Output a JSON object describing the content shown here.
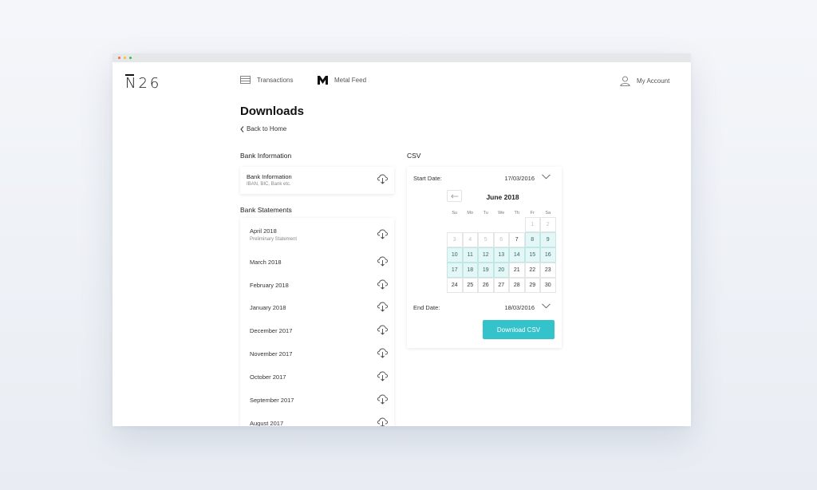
{
  "app": {
    "logo": "N26"
  },
  "nav": {
    "transactions": "Transactions",
    "metal_feed": "Metal Feed",
    "account": "My Account"
  },
  "page": {
    "title": "Downloads",
    "back_label": "Back to Home"
  },
  "bank_info": {
    "section_label": "Bank Information",
    "card_title": "Bank Information",
    "card_sub": "IBAN, BIC, Bank etc."
  },
  "statements": {
    "section_label": "Bank Statements",
    "items": [
      {
        "label": "April 2018",
        "sub": "Preliminary Statement"
      },
      {
        "label": "March 2018",
        "sub": ""
      },
      {
        "label": "February 2018",
        "sub": ""
      },
      {
        "label": "January 2018",
        "sub": ""
      },
      {
        "label": "December 2017",
        "sub": ""
      },
      {
        "label": "November 2017",
        "sub": ""
      },
      {
        "label": "October 2017",
        "sub": ""
      },
      {
        "label": "September 2017",
        "sub": ""
      },
      {
        "label": "August 2017",
        "sub": ""
      }
    ]
  },
  "csv": {
    "section_label": "CSV",
    "start_label": "Start Date:",
    "start_value": "17/03/2016",
    "end_label": "End Date:",
    "end_value": "18/03/2016",
    "button": "Download CSV",
    "calendar": {
      "month": "June 2018",
      "weekdays": [
        "Su",
        "Mo",
        "Tu",
        "We",
        "Th",
        "Fr",
        "Sa"
      ],
      "weeks": [
        [
          null,
          null,
          null,
          null,
          null,
          {
            "d": "1",
            "s": "muted"
          },
          {
            "d": "2",
            "s": "muted"
          }
        ],
        [
          {
            "d": "3",
            "s": "muted"
          },
          {
            "d": "4",
            "s": "muted"
          },
          {
            "d": "5",
            "s": "muted"
          },
          {
            "d": "6",
            "s": "muted"
          },
          {
            "d": "7",
            "s": ""
          },
          {
            "d": "8",
            "s": "sel"
          },
          {
            "d": "9",
            "s": "sel"
          }
        ],
        [
          {
            "d": "10",
            "s": "sel"
          },
          {
            "d": "11",
            "s": "sel"
          },
          {
            "d": "12",
            "s": "sel"
          },
          {
            "d": "13",
            "s": "sel"
          },
          {
            "d": "14",
            "s": "sel"
          },
          {
            "d": "15",
            "s": "sel"
          },
          {
            "d": "16",
            "s": "sel"
          }
        ],
        [
          {
            "d": "17",
            "s": "sel"
          },
          {
            "d": "18",
            "s": "sel"
          },
          {
            "d": "19",
            "s": "sel"
          },
          {
            "d": "20",
            "s": "sel"
          },
          {
            "d": "21",
            "s": ""
          },
          {
            "d": "22",
            "s": ""
          },
          {
            "d": "23",
            "s": ""
          }
        ],
        [
          {
            "d": "24",
            "s": ""
          },
          {
            "d": "25",
            "s": ""
          },
          {
            "d": "26",
            "s": ""
          },
          {
            "d": "27",
            "s": ""
          },
          {
            "d": "28",
            "s": ""
          },
          {
            "d": "29",
            "s": ""
          },
          {
            "d": "30",
            "s": ""
          }
        ]
      ]
    }
  },
  "colors": {
    "accent": "#35c3cb",
    "selected_bg": "#e4f6f5"
  }
}
